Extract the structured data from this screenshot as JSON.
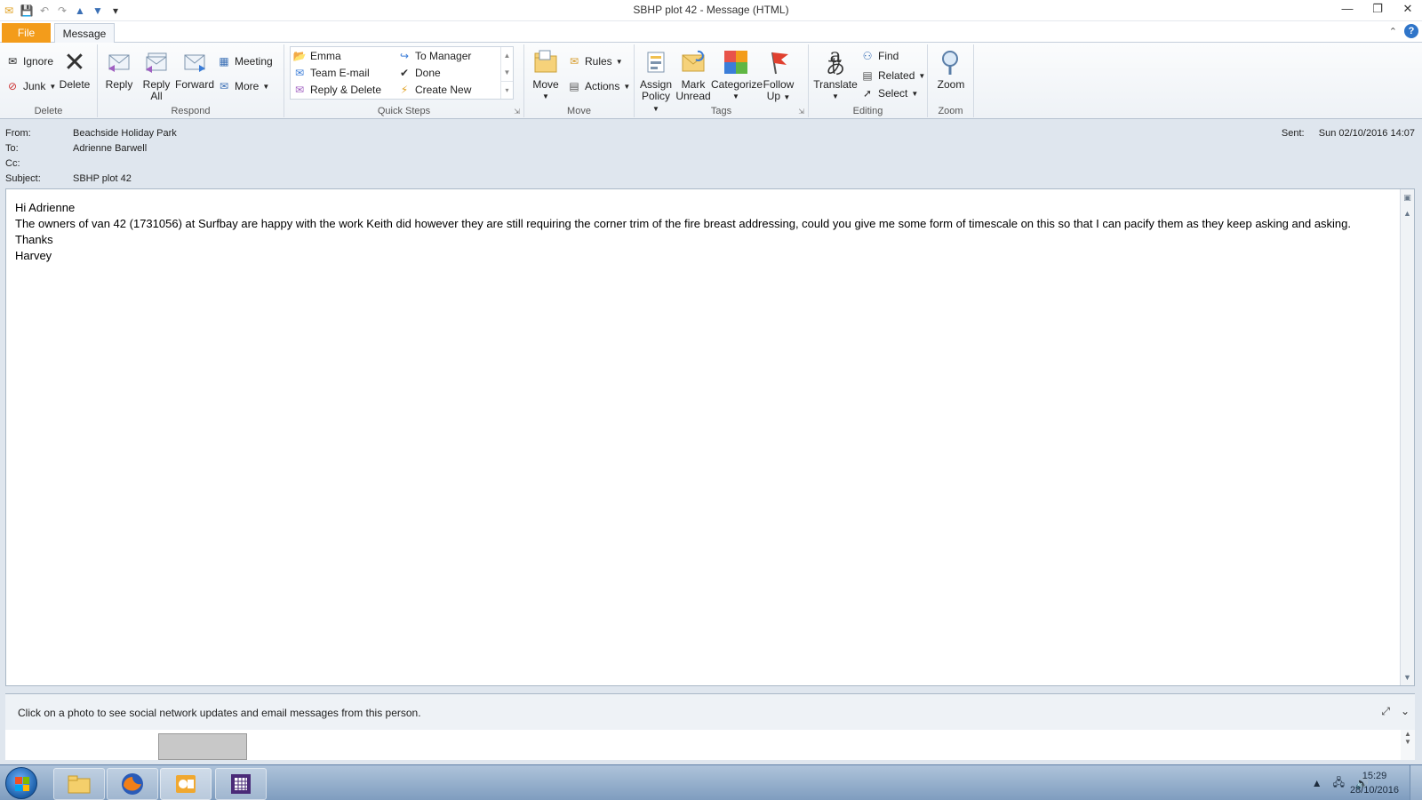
{
  "window": {
    "title": "SBHP plot 42  -  Message (HTML)",
    "controls": [
      "—",
      "❐",
      "✕"
    ]
  },
  "tabs": {
    "file": "File",
    "message": "Message"
  },
  "ribbon": {
    "delete": {
      "label": "Delete",
      "ignore": "Ignore",
      "junk": "Junk",
      "delete": "Delete"
    },
    "respond": {
      "label": "Respond",
      "reply": "Reply",
      "reply_all_1": "Reply",
      "reply_all_2": "All",
      "forward": "Forward",
      "meeting": "Meeting",
      "more": "More"
    },
    "quick_steps": {
      "label": "Quick Steps",
      "items": [
        "Emma",
        "To Manager",
        "Team E-mail",
        "Done",
        "Reply & Delete",
        "Create New"
      ]
    },
    "move": {
      "label": "Move",
      "move": "Move",
      "rules": "Rules",
      "actions": "Actions"
    },
    "tags": {
      "label": "Tags",
      "assign_1": "Assign",
      "assign_2": "Policy",
      "mark_1": "Mark",
      "mark_2": "Unread",
      "categorize": "Categorize",
      "follow_1": "Follow",
      "follow_2": "Up"
    },
    "editing": {
      "label": "Editing",
      "translate": "Translate",
      "find": "Find",
      "related": "Related",
      "select": "Select"
    },
    "zoom": {
      "label": "Zoom",
      "zoom": "Zoom"
    }
  },
  "message": {
    "from_label": "From:",
    "from": "Beachside Holiday Park",
    "to_label": "To:",
    "to": "Adrienne Barwell",
    "cc_label": "Cc:",
    "cc": "",
    "subject_label": "Subject:",
    "subject": "SBHP plot 42",
    "sent_label": "Sent:",
    "sent": "Sun 02/10/2016 14:07",
    "body": {
      "greeting": "Hi Adrienne",
      "paragraph": "The owners of van 42  (1731056) at Surfbay are happy with the work Keith did however they are still requiring the corner trim of the fire breast addressing, could you give me some form of timescale on this so that I can pacify them as they keep asking and asking.",
      "thanks": "Thanks",
      "signature": "Harvey"
    }
  },
  "people_pane": {
    "message": "Click on a photo to see social network updates and email messages from this person."
  },
  "taskbar": {
    "time": "15:29",
    "date": "28/10/2016"
  }
}
